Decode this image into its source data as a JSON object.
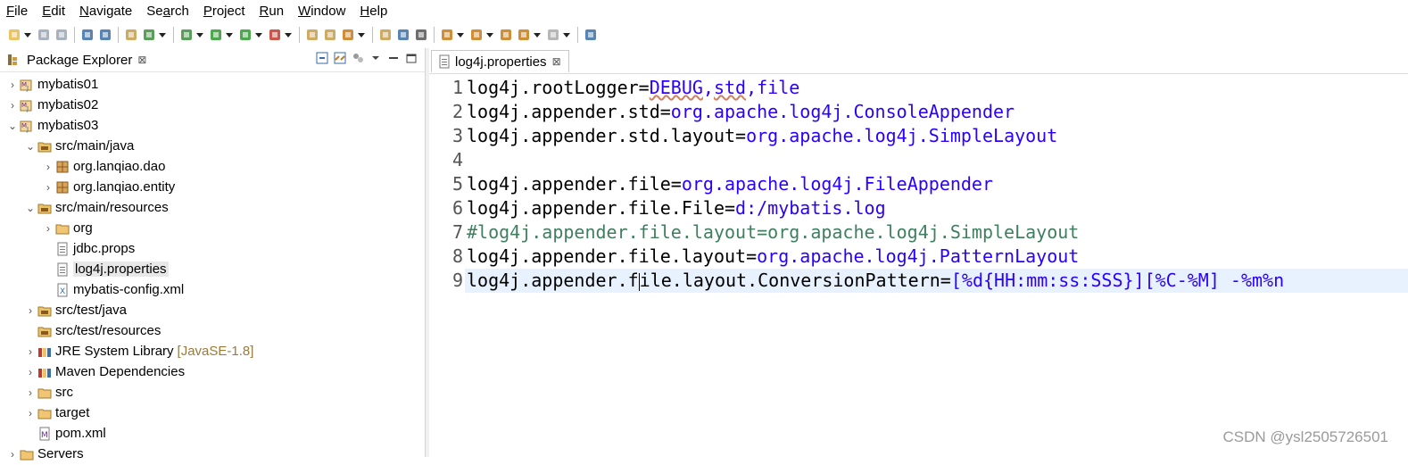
{
  "menu": [
    "File",
    "Edit",
    "Navigate",
    "Search",
    "Project",
    "Run",
    "Window",
    "Help"
  ],
  "menu_mnemonic": [
    "F",
    "E",
    "N",
    "a",
    "P",
    "R",
    "W",
    "H"
  ],
  "package_explorer": {
    "title": "Package Explorer",
    "close": "⊠",
    "tree": [
      {
        "label": "mybatis01",
        "icon": "maven-project-icon",
        "expanded": false,
        "depth": 0
      },
      {
        "label": "mybatis02",
        "icon": "maven-project-icon",
        "expanded": false,
        "depth": 0
      },
      {
        "label": "mybatis03",
        "icon": "maven-project-icon",
        "expanded": true,
        "depth": 0
      },
      {
        "label": "src/main/java",
        "icon": "source-folder-icon",
        "expanded": true,
        "depth": 1
      },
      {
        "label": "org.lanqiao.dao",
        "icon": "package-icon",
        "expanded": false,
        "depth": 2
      },
      {
        "label": "org.lanqiao.entity",
        "icon": "package-icon",
        "expanded": false,
        "depth": 2
      },
      {
        "label": "src/main/resources",
        "icon": "source-folder-icon",
        "expanded": true,
        "depth": 1
      },
      {
        "label": "org",
        "icon": "folder-icon",
        "expanded": false,
        "depth": 2
      },
      {
        "label": "jdbc.props",
        "icon": "file-icon",
        "depth": 2
      },
      {
        "label": "log4j.properties",
        "icon": "file-icon",
        "depth": 2,
        "selected": true
      },
      {
        "label": "mybatis-config.xml",
        "icon": "xml-file-icon",
        "depth": 2
      },
      {
        "label": "src/test/java",
        "icon": "source-folder-icon",
        "expanded": false,
        "depth": 1
      },
      {
        "label": "src/test/resources",
        "icon": "source-folder-icon",
        "depth": 1
      },
      {
        "label": "JRE System Library",
        "extra": "[JavaSE-1.8]",
        "icon": "library-icon",
        "expanded": false,
        "depth": 1
      },
      {
        "label": "Maven Dependencies",
        "icon": "library-icon",
        "expanded": false,
        "depth": 1
      },
      {
        "label": "src",
        "icon": "folder-icon",
        "expanded": false,
        "depth": 1
      },
      {
        "label": "target",
        "icon": "folder-icon",
        "expanded": false,
        "depth": 1
      },
      {
        "label": "pom.xml",
        "icon": "maven-pom-icon",
        "depth": 1
      },
      {
        "label": "Servers",
        "icon": "folder-icon",
        "expanded": false,
        "depth": 0
      }
    ]
  },
  "editor": {
    "tab_label": "log4j.properties",
    "tab_close": "⊠",
    "lines": [
      {
        "n": "1",
        "parts": [
          {
            "t": "log4j.rootLogger=",
            "c": "k"
          },
          {
            "t": "DEBUG",
            "c": "v",
            "squig": true
          },
          {
            "t": ",",
            "c": "v"
          },
          {
            "t": "std",
            "c": "v",
            "squig": true
          },
          {
            "t": ",file",
            "c": "v"
          }
        ]
      },
      {
        "n": "2",
        "parts": [
          {
            "t": "log4j.appender.std=",
            "c": "k"
          },
          {
            "t": "org.apache.log4j.ConsoleAppender",
            "c": "v"
          }
        ]
      },
      {
        "n": "3",
        "parts": [
          {
            "t": "log4j.appender.std.layout=",
            "c": "k"
          },
          {
            "t": "org.apache.log4j.SimpleLayout",
            "c": "v"
          }
        ]
      },
      {
        "n": "4",
        "parts": []
      },
      {
        "n": "5",
        "parts": [
          {
            "t": "log4j.appender.file=",
            "c": "k"
          },
          {
            "t": "org.apache.log4j.FileAppender",
            "c": "v"
          }
        ]
      },
      {
        "n": "6",
        "parts": [
          {
            "t": "log4j.appender.file.File=",
            "c": "k"
          },
          {
            "t": "d:/mybatis.log",
            "c": "v"
          }
        ]
      },
      {
        "n": "7",
        "parts": [
          {
            "t": "#log4j.appender.file.layout=org.apache.log4j.SimpleLayout",
            "c": "c"
          }
        ]
      },
      {
        "n": "8",
        "parts": [
          {
            "t": "log4j.appender.file.layout=",
            "c": "k"
          },
          {
            "t": "org.apache.log4j.PatternLayout",
            "c": "v"
          }
        ]
      },
      {
        "n": "9",
        "parts": [
          {
            "t": "log4j.appender.f",
            "c": "k"
          },
          {
            "caret": true
          },
          {
            "t": "ile.layout.ConversionPattern=",
            "c": "k"
          },
          {
            "t": "[%d{HH:mm:ss:SSS}][%C-%M] -%m%n",
            "c": "v"
          }
        ],
        "current": true
      }
    ]
  },
  "watermark": "CSDN @ysl2505726501",
  "colors": {
    "key": "#000000",
    "value": "#2a00ff",
    "comment": "#3f7f5f",
    "current_line": "#e8f2fe"
  }
}
